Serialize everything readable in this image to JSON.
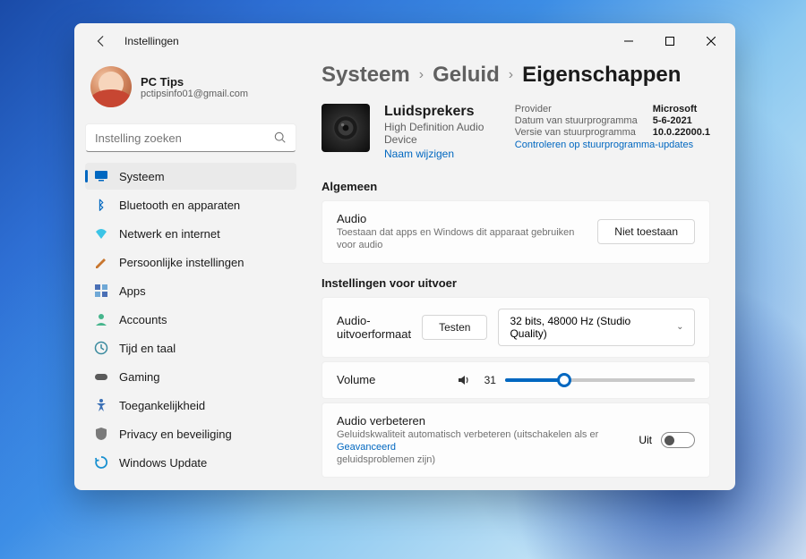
{
  "app_title": "Instellingen",
  "user": {
    "name": "PC Tips",
    "email": "pctipsinfo01@gmail.com"
  },
  "search": {
    "placeholder": "Instelling zoeken"
  },
  "sidebar": {
    "items": [
      {
        "label": "Systeem",
        "icon": "display-icon",
        "active": true
      },
      {
        "label": "Bluetooth en apparaten",
        "icon": "bluetooth-icon"
      },
      {
        "label": "Netwerk en internet",
        "icon": "wifi-icon"
      },
      {
        "label": "Persoonlijke instellingen",
        "icon": "personalize-icon"
      },
      {
        "label": "Apps",
        "icon": "apps-icon"
      },
      {
        "label": "Accounts",
        "icon": "accounts-icon"
      },
      {
        "label": "Tijd en taal",
        "icon": "clock-icon"
      },
      {
        "label": "Gaming",
        "icon": "gaming-icon"
      },
      {
        "label": "Toegankelijkheid",
        "icon": "accessibility-icon"
      },
      {
        "label": "Privacy en beveiliging",
        "icon": "shield-icon"
      },
      {
        "label": "Windows Update",
        "icon": "update-icon"
      }
    ]
  },
  "breadcrumbs": [
    "Systeem",
    "Geluid",
    "Eigenschappen"
  ],
  "device": {
    "name": "Luidsprekers",
    "subtitle": "High Definition Audio Device",
    "rename": "Naam wijzigen"
  },
  "driver": {
    "provider_label": "Provider",
    "provider": "Microsoft",
    "date_label": "Datum van stuurprogramma",
    "date": "5-6-2021",
    "version_label": "Versie van stuurprogramma",
    "version": "10.0.22000.1",
    "check_updates": "Controleren op stuurprogramma-updates"
  },
  "sections": {
    "general": "Algemeen",
    "output": "Instellingen voor uitvoer"
  },
  "audio_setting": {
    "label": "Audio",
    "desc": "Toestaan dat apps en Windows dit apparaat gebruiken voor audio",
    "button": "Niet toestaan"
  },
  "format": {
    "label": "Audio-uitvoerformaat",
    "test": "Testen",
    "value": "32 bits, 48000 Hz (Studio Quality)"
  },
  "volume": {
    "label": "Volume",
    "value": "31",
    "percent": 31
  },
  "enhance": {
    "label": "Audio verbeteren",
    "desc_pre": "Geluidskwaliteit automatisch verbeteren (uitschakelen als er ",
    "link": "Geavanceerd",
    "desc_post": "geluidsproblemen zijn)",
    "toggle_text": "Uit"
  }
}
